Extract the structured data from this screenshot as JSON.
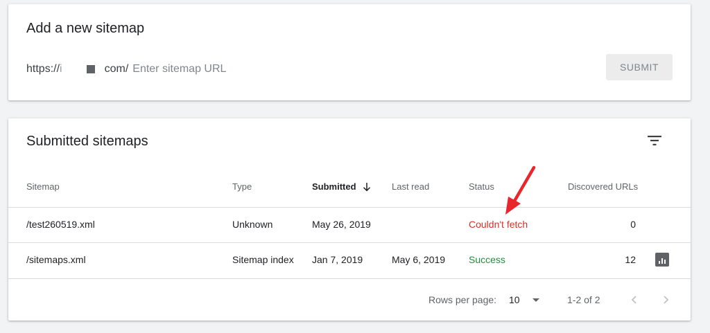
{
  "add_card": {
    "title": "Add a new sitemap",
    "url_prefix": "https://",
    "url_prefix_faint": "i",
    "domain_suffix": "com/",
    "input_placeholder": "Enter sitemap URL",
    "input_value": "",
    "submit_label": "SUBMIT"
  },
  "list_card": {
    "title": "Submitted sitemaps",
    "filter_icon": "filter-list-icon",
    "columns": [
      "Sitemap",
      "Type",
      "Submitted",
      "Last read",
      "Status",
      "Discovered URLs"
    ],
    "sort_column": "Submitted",
    "sort_direction": "descending",
    "rows": [
      {
        "sitemap": "/test260519.xml",
        "type": "Unknown",
        "submitted": "May 26, 2019",
        "last_read": "",
        "status": "Couldn't fetch",
        "discovered": "0"
      },
      {
        "sitemap": "/sitemaps.xml",
        "type": "Sitemap index",
        "submitted": "Jan 7, 2019",
        "last_read": "May 6, 2019",
        "status": "Success",
        "discovered": "12"
      }
    ],
    "pagination": {
      "rows_per_page_label": "Rows per page:",
      "rows_per_page": "10",
      "range": "1-2 of 2"
    }
  },
  "colors": {
    "status_error": "#d93025",
    "status_success": "#1e8e3e",
    "annotation_arrow": "#e8262b"
  }
}
